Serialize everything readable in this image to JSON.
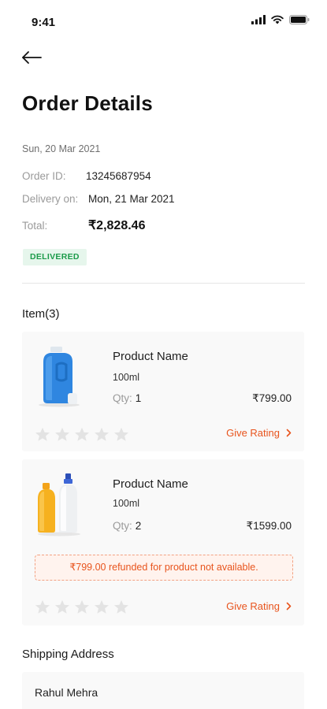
{
  "status_bar": {
    "time": "9:41"
  },
  "header": {
    "title": "Order Details",
    "back_icon": "arrow-left-icon"
  },
  "order": {
    "date": "Sun, 20 Mar 2021",
    "order_id_label": "Order ID:",
    "order_id": "13245687954",
    "delivery_label": "Delivery on:",
    "delivery_date": "Mon, 21 Mar 2021",
    "total_label": "Total:",
    "total": "₹2,828.46",
    "status": "DELIVERED"
  },
  "items_heading": "Item(3)",
  "items": [
    {
      "name": "Product Name",
      "size": "100ml",
      "qty_label": "Qty:",
      "qty": "1",
      "price": "₹799.00",
      "rating_label": "Give Rating",
      "image_icon": "blue-detergent-bottle-icon"
    },
    {
      "name": "Product Name",
      "size": "100ml",
      "qty_label": "Qty:",
      "qty": "2",
      "price": "₹1599.00",
      "refund_note": "₹799.00 refunded for product not available.",
      "rating_label": "Give Rating",
      "image_icon": "cleaning-bottles-icon"
    }
  ],
  "shipping": {
    "heading": "Shipping Address",
    "name": "Rahul Mehra"
  },
  "colors": {
    "accent": "#e8541d",
    "delivered_text": "#1c9b4a",
    "delivered_bg": "#e6f6ec",
    "card_bg": "#f9f9f9"
  }
}
